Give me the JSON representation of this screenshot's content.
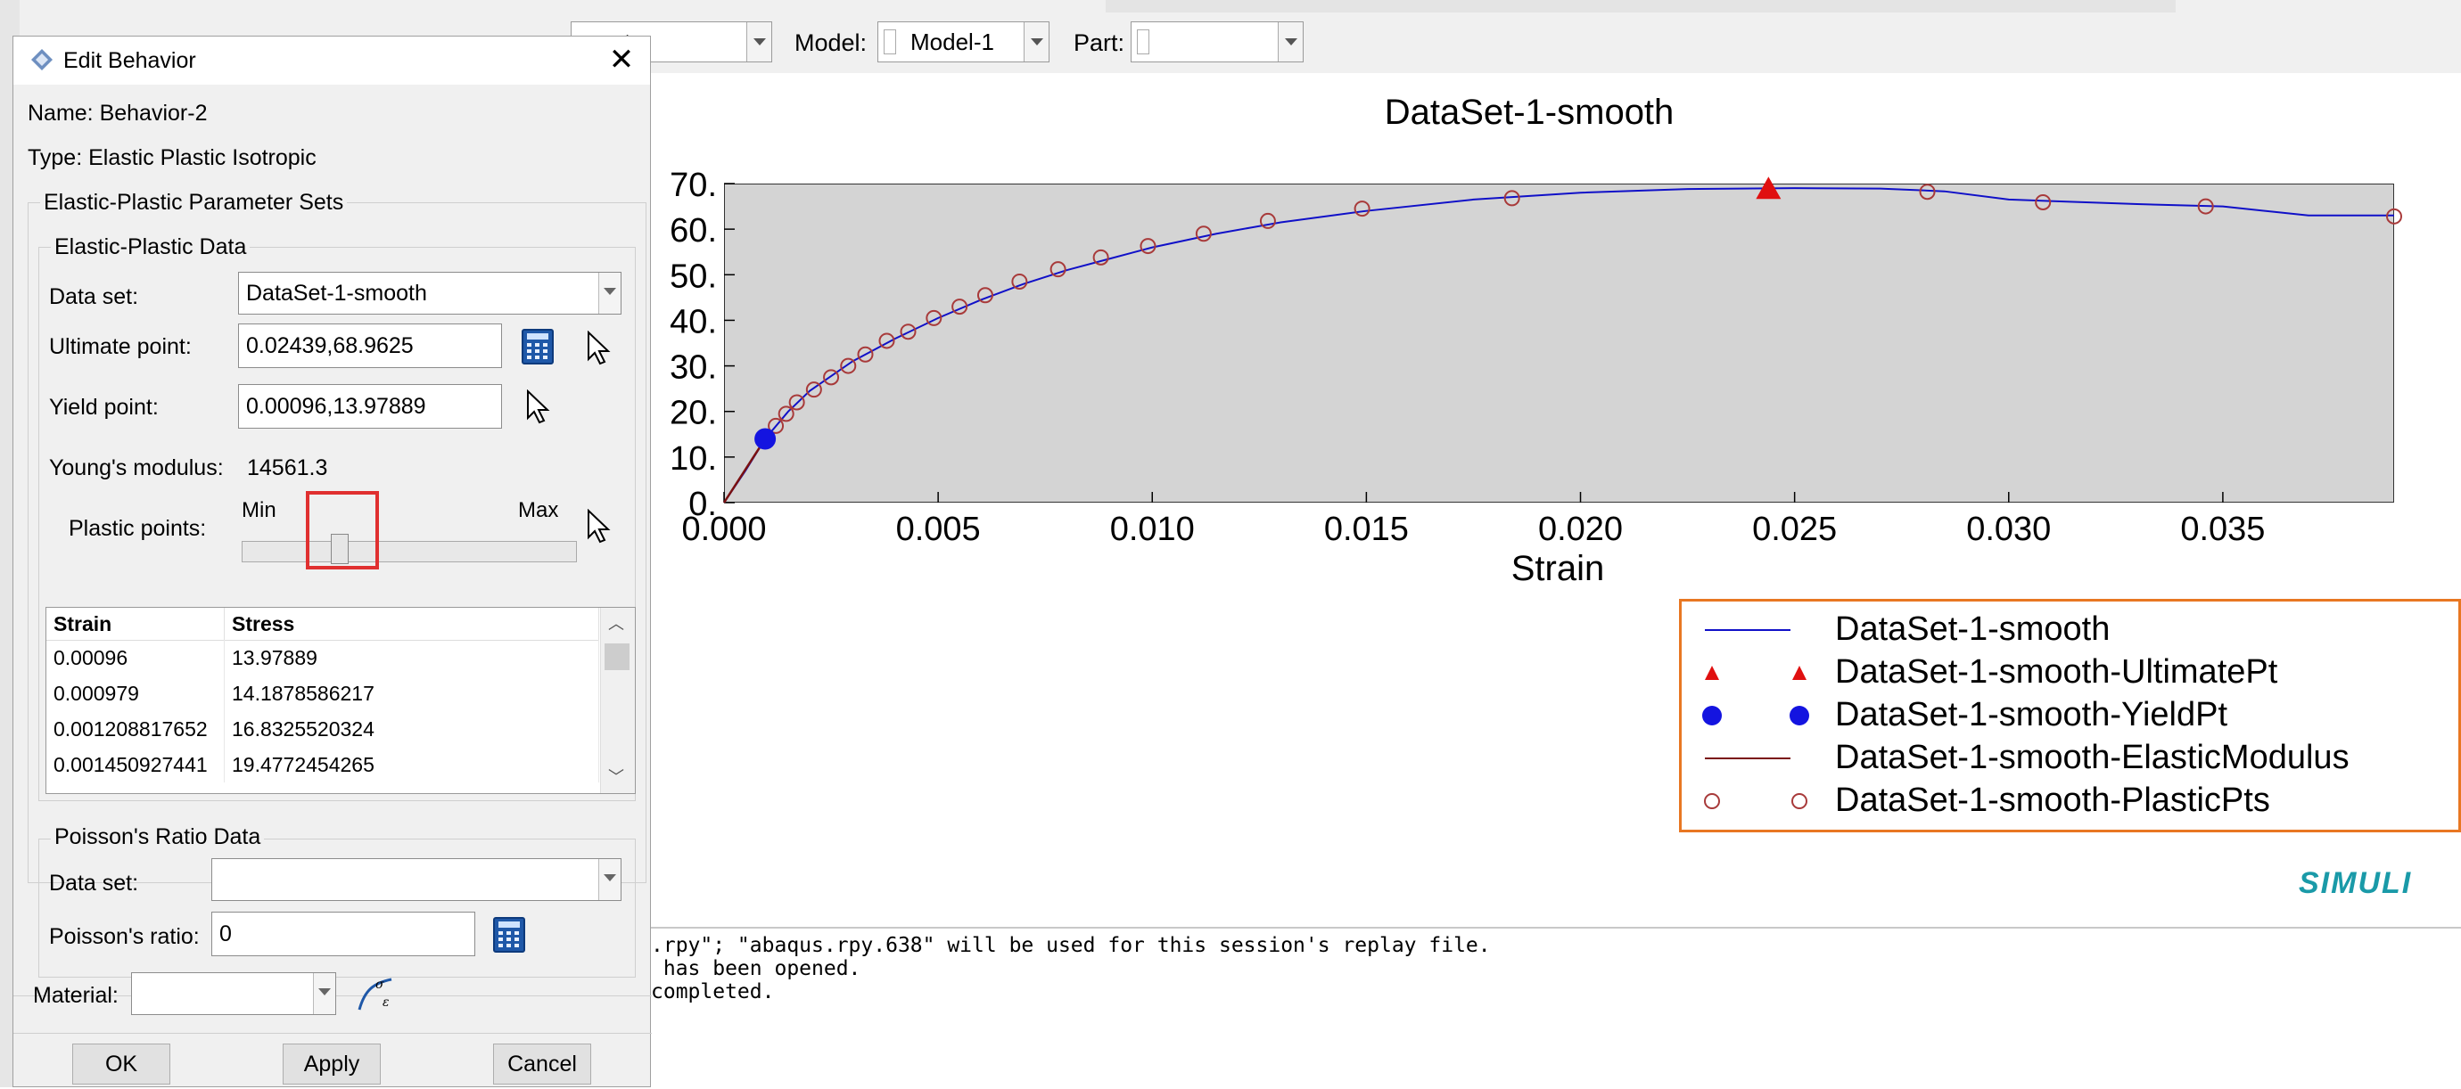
{
  "toolbar": {
    "module_partial": "erty",
    "model_label": "Model:",
    "model_value": "Model-1",
    "part_label": "Part:",
    "part_value": ""
  },
  "dialog": {
    "title": "Edit Behavior",
    "name_line": "Name: Behavior-2",
    "type_line": "Type: Elastic Plastic Isotropic",
    "param_sets_title": "Elastic-Plastic Parameter Sets",
    "ep_data_title": "Elastic-Plastic Data",
    "dataset_label": "Data set:",
    "dataset_value": "DataSet-1-smooth",
    "ultimate_label": "Ultimate point:",
    "ultimate_value": "0.02439,68.9625",
    "yield_label": "Yield point:",
    "yield_value": "0.00096,13.97889",
    "youngs_label": "Young's modulus:",
    "youngs_value": "14561.3",
    "plastic_label": "Plastic points:",
    "slider_min": "Min",
    "slider_max": "Max",
    "table": {
      "headers": [
        "Strain",
        "Stress"
      ],
      "rows": [
        [
          "0.00096",
          "13.97889"
        ],
        [
          "0.000979",
          "14.1878586217"
        ],
        [
          "0.001208817652",
          "16.8325520324"
        ],
        [
          "0.001450927441",
          "19.4772454265"
        ]
      ]
    },
    "poisson_title": "Poisson's Ratio Data",
    "poisson_dataset_label": "Data set:",
    "poisson_dataset_value": "",
    "poisson_ratio_label": "Poisson's ratio:",
    "poisson_ratio_value": "0",
    "material_label": "Material:",
    "material_value": "",
    "ok": "OK",
    "apply": "Apply",
    "cancel": "Cancel"
  },
  "messages": [
    ".rpy\"; \"abaqus.rpy.638\" will be used for this session's replay file.",
    " has been opened.",
    "completed."
  ],
  "brand": "SIMULI",
  "chart_data": {
    "type": "line",
    "title": "DataSet-1-smooth",
    "xlabel": "Strain",
    "ylabel": "",
    "xlim": [
      0.0,
      0.039
    ],
    "ylim": [
      0.0,
      70.0
    ],
    "x_ticks": [
      "0.000",
      "0.005",
      "0.010",
      "0.015",
      "0.020",
      "0.025",
      "0.030",
      "0.035"
    ],
    "y_ticks": [
      "0.",
      "10.",
      "20.",
      "30.",
      "40.",
      "50.",
      "60.",
      "70."
    ],
    "grid": false,
    "legend_position": "bottom-right, outside plot",
    "colors": {
      "curve": "#1010c8",
      "ultimate": "#e01010",
      "yield": "#1414e0",
      "elastic": "#7a1010",
      "plastic": "#a83a3a",
      "legend_border": "#e87722"
    },
    "series": [
      {
        "name": "DataSet-1-smooth",
        "x": [
          0.0,
          0.0005,
          0.00096,
          0.0015,
          0.002,
          0.003,
          0.004,
          0.005,
          0.006,
          0.007,
          0.008,
          0.009,
          0.01,
          0.0115,
          0.013,
          0.015,
          0.0175,
          0.02,
          0.0225,
          0.025,
          0.027,
          0.0285,
          0.03,
          0.0315,
          0.033,
          0.035,
          0.037,
          0.039
        ],
        "y": [
          0.0,
          7.0,
          13.98,
          20.0,
          24.5,
          31.0,
          36.0,
          40.5,
          44.5,
          48.0,
          51.0,
          53.5,
          56.0,
          59.0,
          61.5,
          64.0,
          66.5,
          68.0,
          68.8,
          69.0,
          68.9,
          68.3,
          66.5,
          66.0,
          65.5,
          65.0,
          63.0,
          63.0
        ]
      },
      {
        "name": "DataSet-1-smooth-UltimatePt",
        "x": [
          0.02439
        ],
        "y": [
          68.9625
        ]
      },
      {
        "name": "DataSet-1-smooth-YieldPt",
        "x": [
          0.00096
        ],
        "y": [
          13.97889
        ]
      },
      {
        "name": "DataSet-1-smooth-ElasticModulus",
        "x": [
          0.0,
          0.00096
        ],
        "y": [
          0.0,
          13.97889
        ]
      },
      {
        "name": "DataSet-1-smooth-PlasticPts",
        "x": [
          0.00096,
          0.000979,
          0.001209,
          0.001451,
          0.0017,
          0.0021,
          0.0025,
          0.0029,
          0.0033,
          0.0038,
          0.0043,
          0.0049,
          0.0055,
          0.0061,
          0.0069,
          0.0078,
          0.0088,
          0.0099,
          0.0112,
          0.0127,
          0.0149,
          0.0184,
          0.0281,
          0.0308,
          0.0346,
          0.039
        ],
        "y": [
          13.98,
          14.19,
          16.83,
          19.48,
          22.0,
          24.8,
          27.5,
          30.0,
          32.5,
          35.5,
          37.5,
          40.5,
          43.0,
          45.5,
          48.5,
          51.2,
          53.8,
          56.3,
          59.0,
          61.8,
          64.5,
          66.8,
          68.2,
          65.9,
          65.0,
          62.8
        ]
      }
    ]
  }
}
